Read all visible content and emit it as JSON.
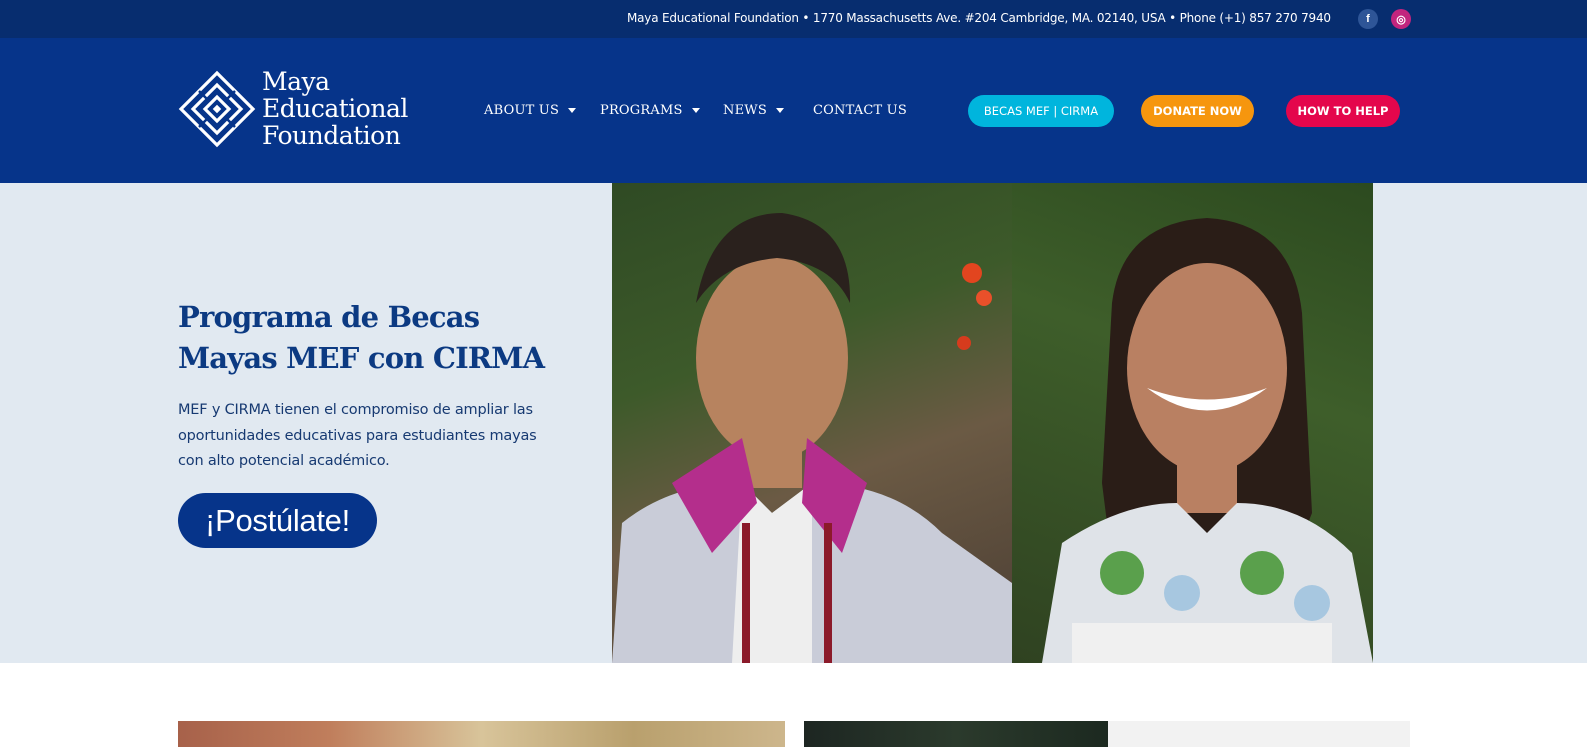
{
  "topbar": {
    "contact_line": "Maya Educational Foundation • 1770 Massachusetts Ave. #204 Cambridge, MA. 02140, USA • Phone (+1) 857 270 7940",
    "social": [
      {
        "icon": "facebook-icon",
        "glyph": "f",
        "color": "#2e5597"
      },
      {
        "icon": "instagram-icon",
        "glyph": "◎",
        "color": "#c2257e"
      }
    ]
  },
  "header": {
    "logo": {
      "line1": "Maya",
      "line2": "Educational",
      "line3": "Foundation"
    },
    "nav": [
      {
        "label": "ABOUT US",
        "has_dropdown": true
      },
      {
        "label": "PROGRAMS",
        "has_dropdown": true
      },
      {
        "label": "NEWS",
        "has_dropdown": true
      },
      {
        "label": "CONTACT US",
        "has_dropdown": false
      }
    ],
    "buttons": {
      "becas": "BECAS MEF | CIRMA",
      "donate": "DONATE NOW",
      "help": "HOW TO HELP"
    }
  },
  "hero": {
    "title": "Programa de Becas Mayas MEF con CIRMA",
    "description": "MEF y CIRMA tienen el compromiso de ampliar las oportunidades educativas para estudiantes mayas con alto potencial académico.",
    "cta": "¡Postúlate!"
  },
  "colors": {
    "topbar": "#072d6f",
    "header": "#06348a",
    "hero_bg": "#e1e9f1",
    "becas": "#00b5dd",
    "donate": "#f6960e",
    "help": "#e4064c"
  }
}
